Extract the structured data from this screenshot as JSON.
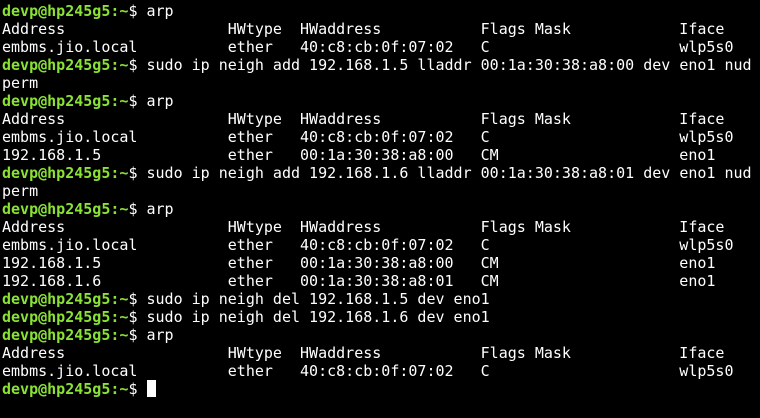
{
  "terminal": {
    "prompt_user": "devp@hp245g5",
    "prompt_path": ":~",
    "prompt_symbol": "$ ",
    "lines": [
      {
        "type": "cmd",
        "text": "arp"
      },
      {
        "type": "out",
        "text": "Address                  HWtype  HWaddress           Flags Mask            Iface"
      },
      {
        "type": "out",
        "text": "embms.jio.local          ether   40:c8:cb:0f:07:02   C                     wlp5s0"
      },
      {
        "type": "cmd",
        "text": "sudo ip neigh add 192.168.1.5 lladdr 00:1a:30:38:a8:00 dev eno1 nud"
      },
      {
        "type": "out",
        "text": "perm"
      },
      {
        "type": "cmd",
        "text": "arp"
      },
      {
        "type": "out",
        "text": "Address                  HWtype  HWaddress           Flags Mask            Iface"
      },
      {
        "type": "out",
        "text": "embms.jio.local          ether   40:c8:cb:0f:07:02   C                     wlp5s0"
      },
      {
        "type": "out",
        "text": "192.168.1.5              ether   00:1a:30:38:a8:00   CM                    eno1"
      },
      {
        "type": "cmd",
        "text": "sudo ip neigh add 192.168.1.6 lladdr 00:1a:30:38:a8:01 dev eno1 nud"
      },
      {
        "type": "out",
        "text": "perm"
      },
      {
        "type": "cmd",
        "text": "arp"
      },
      {
        "type": "out",
        "text": "Address                  HWtype  HWaddress           Flags Mask            Iface"
      },
      {
        "type": "out",
        "text": "embms.jio.local          ether   40:c8:cb:0f:07:02   C                     wlp5s0"
      },
      {
        "type": "out",
        "text": "192.168.1.5              ether   00:1a:30:38:a8:00   CM                    eno1"
      },
      {
        "type": "out",
        "text": "192.168.1.6              ether   00:1a:30:38:a8:01   CM                    eno1"
      },
      {
        "type": "cmd",
        "text": "sudo ip neigh del 192.168.1.5 dev eno1"
      },
      {
        "type": "cmd",
        "text": "sudo ip neigh del 192.168.1.6 dev eno1"
      },
      {
        "type": "cmd",
        "text": "arp"
      },
      {
        "type": "out",
        "text": "Address                  HWtype  HWaddress           Flags Mask            Iface"
      },
      {
        "type": "out",
        "text": "embms.jio.local          ether   40:c8:cb:0f:07:02   C                     wlp5s0"
      },
      {
        "type": "cursor",
        "text": ""
      }
    ]
  },
  "colors": {
    "background": "#000000",
    "prompt": "#8ae234",
    "text": "#ffffff"
  }
}
